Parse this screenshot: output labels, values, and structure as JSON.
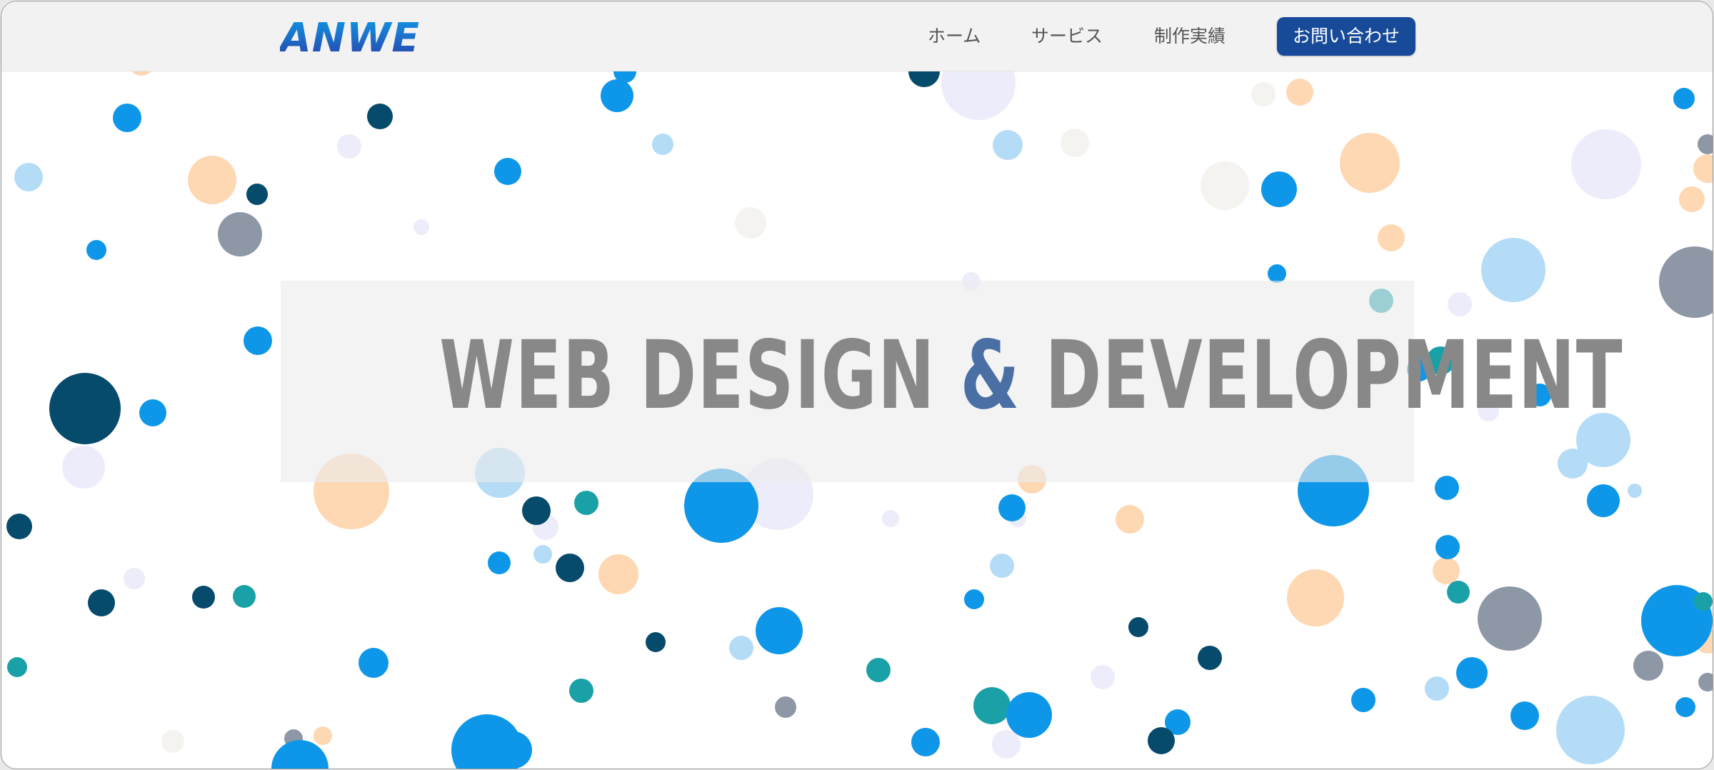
{
  "header": {
    "logo_text": "ANWE",
    "nav": {
      "home": "ホーム",
      "services": "サービス",
      "works": "制作実績",
      "contact": "お問い合わせ"
    }
  },
  "hero": {
    "title_part1": "WEB DESIGN ",
    "title_amp": "&",
    "title_part2": " DEVELOPMENT"
  },
  "colors": {
    "nav_contact_bg": "#174b9a",
    "hero_amp": "#4a6fa5",
    "bubbles": [
      "#0e97e8",
      "#064a6c",
      "#b4dcf7",
      "#fdd8b2",
      "#8d97a6",
      "#1aa1a7",
      "#ececfb",
      "#f5f3ef"
    ]
  }
}
